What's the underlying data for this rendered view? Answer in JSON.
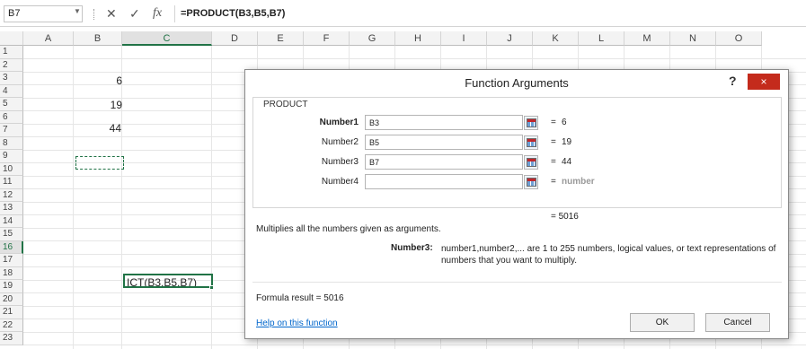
{
  "formula_bar": {
    "name_box": "B7",
    "cancel_symbol": "✕",
    "enter_symbol": "✓",
    "fx_symbol": "fx",
    "formula": "=PRODUCT(B3,B5,B7)"
  },
  "columns": [
    "A",
    "B",
    "C",
    "D",
    "E",
    "F",
    "G",
    "H",
    "I",
    "J",
    "K",
    "L",
    "M",
    "N",
    "O"
  ],
  "rows": [
    "1",
    "2",
    "3",
    "4",
    "5",
    "6",
    "7",
    "8",
    "9",
    "10",
    "11",
    "12",
    "13",
    "14",
    "15",
    "16",
    "17",
    "18",
    "19",
    "20",
    "21",
    "22",
    "23"
  ],
  "cells": {
    "B3": "6",
    "B5": "19",
    "B7": "44",
    "C16": "ICT(B3,B5,B7)"
  },
  "dialog": {
    "title": "Function Arguments",
    "help_symbol": "?",
    "close_symbol": "×",
    "function_name": "PRODUCT",
    "args": [
      {
        "label": "Number1",
        "value": "B3",
        "eq": "=",
        "result": "6",
        "bold": true
      },
      {
        "label": "Number2",
        "value": "B5",
        "eq": "=",
        "result": "19",
        "bold": false
      },
      {
        "label": "Number3",
        "value": "B7",
        "eq": "=",
        "result": "44",
        "bold": false
      },
      {
        "label": "Number4",
        "value": "",
        "eq": "=",
        "result": "number",
        "bold": false
      }
    ],
    "overall_result": "=  5016",
    "description": "Multiplies all the numbers given as arguments.",
    "arg_desc_name": "Number3:",
    "arg_desc_text": "number1,number2,... are 1 to 255 numbers, logical values, or text representations of numbers that you want to multiply.",
    "formula_result": "Formula result =   5016",
    "help_link": "Help on this function",
    "ok_label": "OK",
    "cancel_label": "Cancel"
  }
}
